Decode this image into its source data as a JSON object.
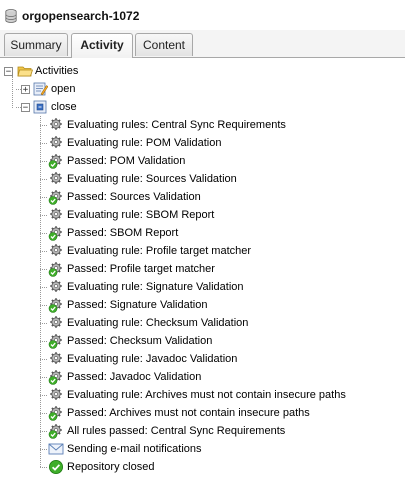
{
  "header": {
    "title": "orgopensearch-1072",
    "icon": "repository-icon"
  },
  "tabs": [
    {
      "label": "Summary",
      "active": false
    },
    {
      "label": "Activity",
      "active": true
    },
    {
      "label": "Content",
      "active": false
    }
  ],
  "tree": {
    "root_label": "Activities",
    "open_label": "open",
    "close_label": "close",
    "events": [
      {
        "label": "Evaluating rules: Central Sync Requirements",
        "icon": "gear-icon"
      },
      {
        "label": "Evaluating rule: POM Validation",
        "icon": "gear-icon"
      },
      {
        "label": "Passed: POM Validation",
        "icon": "gear-check-icon"
      },
      {
        "label": "Evaluating rule: Sources Validation",
        "icon": "gear-icon"
      },
      {
        "label": "Passed: Sources Validation",
        "icon": "gear-check-icon"
      },
      {
        "label": "Evaluating rule: SBOM Report",
        "icon": "gear-icon"
      },
      {
        "label": "Passed: SBOM Report",
        "icon": "gear-check-icon"
      },
      {
        "label": "Evaluating rule: Profile target matcher",
        "icon": "gear-icon"
      },
      {
        "label": "Passed: Profile target matcher",
        "icon": "gear-check-icon"
      },
      {
        "label": "Evaluating rule: Signature Validation",
        "icon": "gear-icon"
      },
      {
        "label": "Passed: Signature Validation",
        "icon": "gear-check-icon"
      },
      {
        "label": "Evaluating rule: Checksum Validation",
        "icon": "gear-icon"
      },
      {
        "label": "Passed: Checksum Validation",
        "icon": "gear-check-icon"
      },
      {
        "label": "Evaluating rule: Javadoc Validation",
        "icon": "gear-icon"
      },
      {
        "label": "Passed: Javadoc Validation",
        "icon": "gear-check-icon"
      },
      {
        "label": "Evaluating rule: Archives must not contain insecure paths",
        "icon": "gear-icon"
      },
      {
        "label": "Passed: Archives must not contain insecure paths",
        "icon": "gear-check-icon"
      },
      {
        "label": "All rules passed: Central Sync Requirements",
        "icon": "gear-check-icon"
      },
      {
        "label": "Sending e-mail notifications",
        "icon": "envelope-icon"
      },
      {
        "label": "Repository closed",
        "icon": "green-check-icon"
      }
    ]
  },
  "colors": {
    "folder": "#f0c64a",
    "check": "#3fae2a",
    "gear": "#8a8a8a",
    "tab_border": "#a8a8a8"
  }
}
